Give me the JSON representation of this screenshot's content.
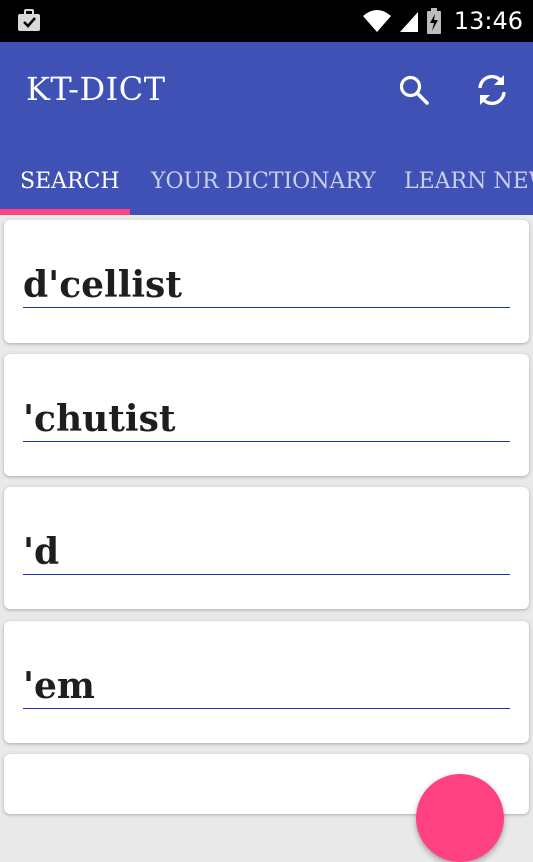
{
  "status_bar": {
    "time": "13:46",
    "icons": [
      "briefcase-check-icon",
      "wifi-icon",
      "signal-icon",
      "battery-charging-icon"
    ]
  },
  "app_bar": {
    "title": "KT-DICT",
    "actions": [
      "search-icon",
      "sync-icon"
    ]
  },
  "tabs": [
    {
      "label": "SEARCH",
      "selected": true
    },
    {
      "label": "YOUR DICTIONARY",
      "selected": false
    },
    {
      "label": "LEARN NEW",
      "selected": false
    }
  ],
  "words": [
    "d'cellist",
    "'chutist",
    "'d",
    "'em",
    ""
  ],
  "colors": {
    "primary": "#3f51b5",
    "accent": "#ff4081",
    "status_bar": "#000000",
    "underline": "#1f2fbf"
  },
  "fab": {
    "icon": "fab-icon"
  }
}
